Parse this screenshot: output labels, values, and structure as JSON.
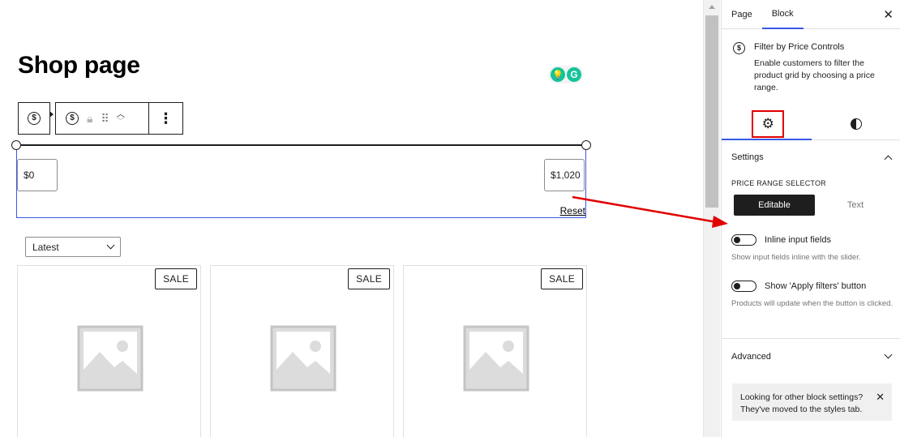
{
  "editor": {
    "page_title": "Shop page",
    "grammarly_letter": "G",
    "price": {
      "min_value": "$0",
      "max_value": "$1,020",
      "reset_label": "Reset"
    },
    "sort": {
      "selected": "Latest"
    },
    "products": [
      {
        "badge": "SALE"
      },
      {
        "badge": "SALE"
      },
      {
        "badge": "SALE"
      }
    ]
  },
  "sidebar": {
    "tabs": [
      {
        "label": "Page"
      },
      {
        "label": "Block"
      }
    ],
    "active_tab": "Block",
    "block": {
      "title": "Filter by Price Controls",
      "description": "Enable customers to filter the product grid by choosing a price range."
    },
    "settings": {
      "heading": "Settings",
      "price_range_label": "PRICE RANGE SELECTOR",
      "segment_options": [
        "Editable",
        "Text"
      ],
      "segment_selected": "Editable",
      "inline_label": "Inline input fields",
      "inline_help": "Show input fields inline with the slider.",
      "apply_label": "Show 'Apply filters' button",
      "apply_help": "Products will update when the button is clicked."
    },
    "advanced_heading": "Advanced",
    "notice": "Looking for other block settings? They've moved to the styles tab."
  },
  "colors": {
    "accent": "#3858e9",
    "highlight": "#e10000",
    "dark": "#1e1e1e"
  },
  "icons": [
    "dollar-coin-icon",
    "lock-icon",
    "drag-handle-icon",
    "chevron-up-icon",
    "chevron-down-icon",
    "more-vertical-icon",
    "close-icon",
    "gear-icon",
    "contrast-icon",
    "image-placeholder-icon"
  ]
}
